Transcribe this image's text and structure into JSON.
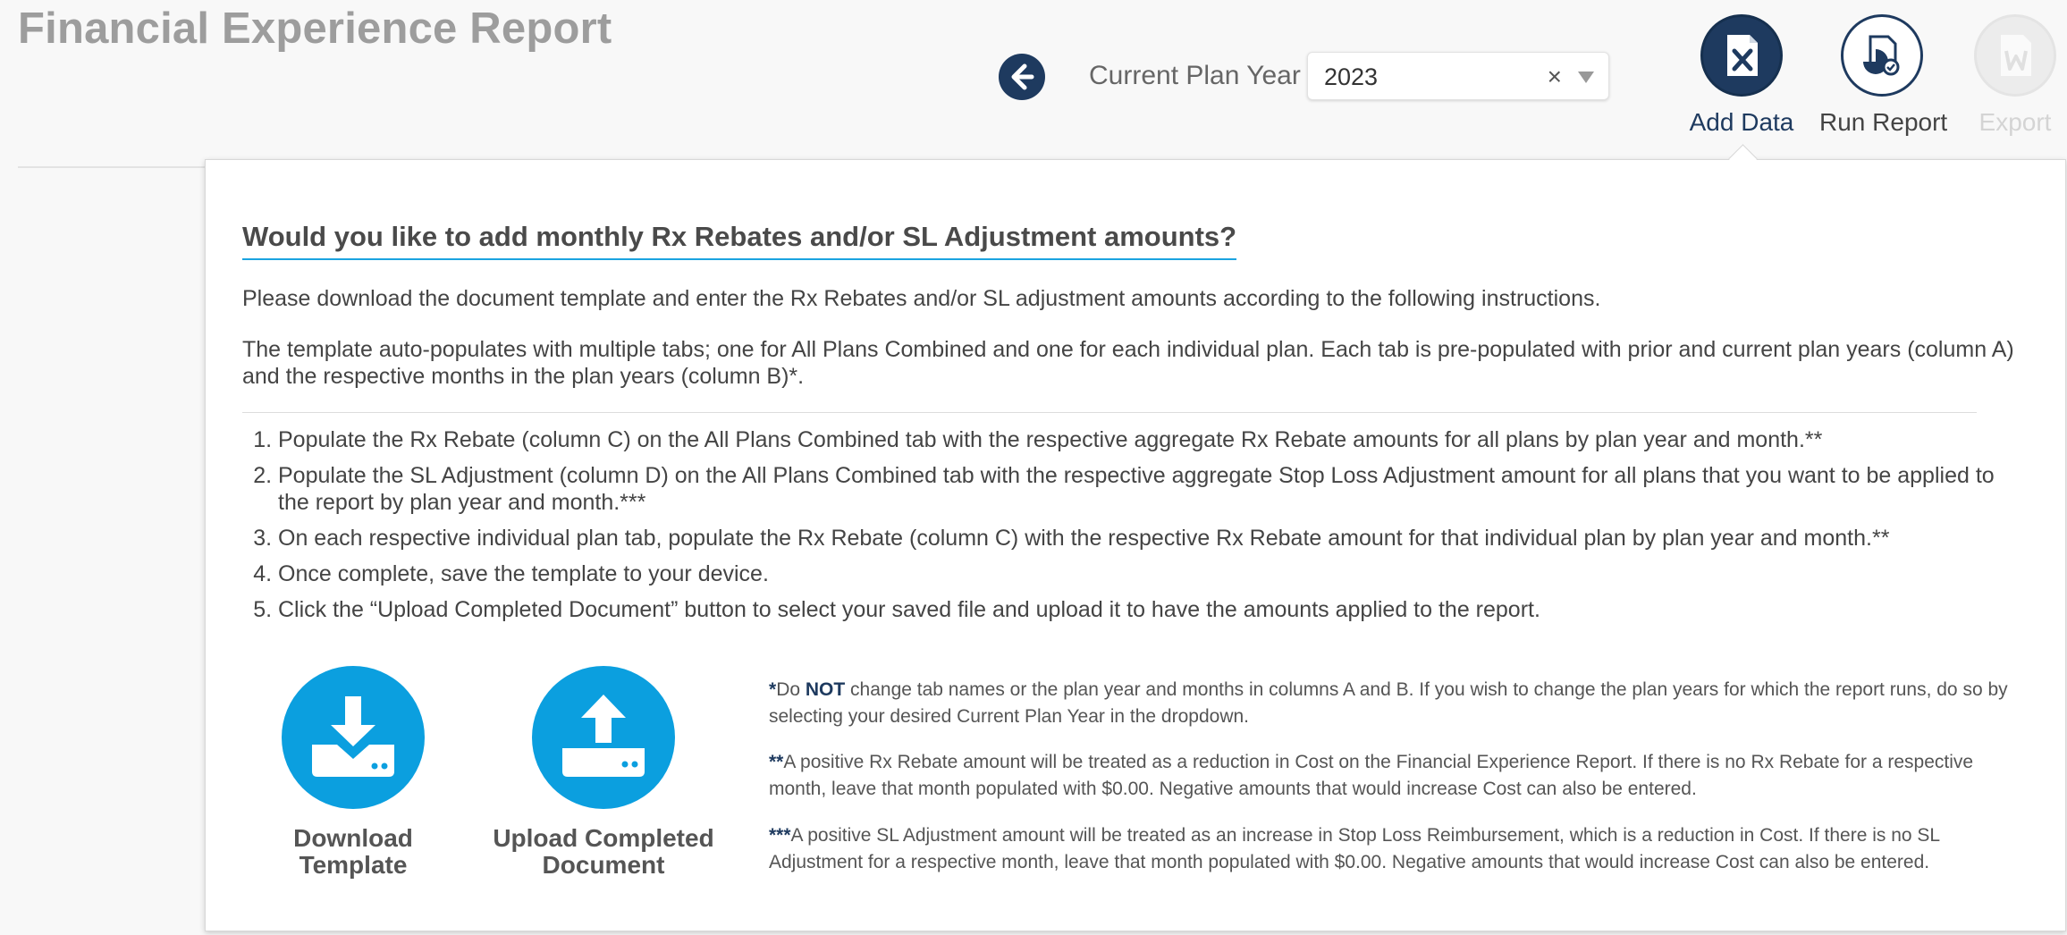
{
  "header": {
    "title": "Financial Experience Report",
    "plan_year_label": "Current Plan Year",
    "plan_year_value": "2023"
  },
  "toolbar": {
    "add_data_label": "Add Data",
    "run_report_label": "Run Report",
    "export_label": "Export"
  },
  "panel": {
    "heading": "Would you like to add monthly Rx Rebates and/or SL Adjustment amounts?",
    "intro": "Please download the document template and enter the Rx Rebates and/or SL adjustment amounts according to the following instructions.",
    "template_info": "The template auto-populates with multiple tabs; one for All Plans Combined and one for each individual plan. Each tab is pre-populated with prior and current plan years (column A) and the respective months in the plan years (column B)*.",
    "steps": [
      "Populate the Rx Rebate (column C) on the All Plans Combined tab with the respective aggregate Rx Rebate amounts for all plans by plan year and month.**",
      "Populate the SL Adjustment (column D) on the All Plans Combined tab with the respective aggregate Stop Loss Adjustment amount for all plans that you want to be applied to the report by plan year and month.***",
      "On each respective individual plan tab, populate the Rx Rebate (column C) with the respective Rx Rebate amount for that individual plan by plan year and month.**",
      "Once complete, save the template to your device.",
      "Click the “Upload Completed Document” button to select your saved file and upload it to have the amounts applied to the report."
    ],
    "download_label": "Download\nTemplate",
    "upload_label": "Upload Completed\nDocument",
    "notes": {
      "n1_marker": "*",
      "n1_pre": "Do ",
      "n1_em": "NOT",
      "n1_post": " change tab names or the plan year and months in columns A and B. If you wish to change the plan years for which the report runs, do so by selecting your desired Current Plan Year in the dropdown.",
      "n2_marker": "**",
      "n2_text": "A positive Rx Rebate amount will be treated as a reduction in Cost on the Financial Experience Report. If there is no Rx Rebate for a respective month, leave that month populated with $0.00. Negative amounts that would increase Cost can also be entered.",
      "n3_marker": "***",
      "n3_text": "A positive SL Adjustment amount will be treated as an increase in Stop Loss Reimbursement, which is a reduction in Cost. If there is no SL Adjustment for a respective month, leave that month populated with $0.00. Negative amounts that would increase Cost can also be entered."
    }
  },
  "icons": {
    "back": "arrow-left-circle",
    "add_data": "excel-file-icon",
    "run_report": "report-chart-icon",
    "export": "word-file-icon",
    "download": "download-tray-icon",
    "upload": "upload-tray-icon",
    "clear": "×"
  },
  "colors": {
    "navy": "#1e3a5f",
    "accent_blue": "#0b9fdf",
    "title_gray": "#9d9d9d"
  }
}
